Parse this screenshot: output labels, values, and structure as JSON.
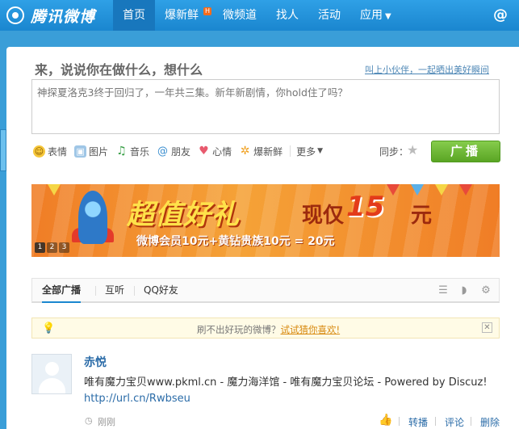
{
  "header": {
    "logo_text": "腾讯微博",
    "nav": [
      {
        "label": "首页",
        "active": true
      },
      {
        "label": "爆新鲜",
        "badge": "H"
      },
      {
        "label": "微频道"
      },
      {
        "label": "找人"
      },
      {
        "label": "活动"
      },
      {
        "label": "应用"
      }
    ],
    "at_icon": "@"
  },
  "composer": {
    "prompt": "来，说说你在做什么，想什么",
    "invite_link": "叫上小伙伴，一起晒出美好瞬间",
    "textarea_value": "神探夏洛克3终于回归了，一年共三集。新年新剧情，你hold住了吗？",
    "tools": [
      {
        "icon": "emoji-icon",
        "label": "表情"
      },
      {
        "icon": "image-icon",
        "label": "图片"
      },
      {
        "icon": "music-icon",
        "label": "音乐"
      },
      {
        "icon": "at-icon",
        "label": "朋友"
      },
      {
        "icon": "heart-icon",
        "label": "心情"
      },
      {
        "icon": "hot-icon",
        "label": "爆新鲜"
      }
    ],
    "more_label": "更多",
    "sync_label": "同步：",
    "broadcast_label": "广播"
  },
  "banner": {
    "title": "超值好礼",
    "title2": "现仅",
    "price": "15",
    "unit": "元",
    "subtitle": "微博会员10元+黄钻贵族10元 = 20元",
    "pages": [
      "1",
      "2",
      "3"
    ]
  },
  "tabs": {
    "items": [
      "全部广播",
      "互听",
      "QQ好友"
    ]
  },
  "tip": {
    "text": "刷不出好玩的微博？",
    "link": "试试猜你喜欢!"
  },
  "feed": {
    "author": "赤悦",
    "content": "唯有魔力宝贝www.pkml.cn - 魔力海洋馆 - 唯有魔力宝贝论坛 - Powered by Discuz!",
    "link": "http://url.cn/Rwbseu",
    "time": "刚刚",
    "actions": [
      "转播",
      "评论",
      "删除"
    ]
  },
  "colors": {
    "nav_bg": "#1a86cf",
    "broadcast_button": "#5aa524",
    "link": "#2b6ca8"
  }
}
